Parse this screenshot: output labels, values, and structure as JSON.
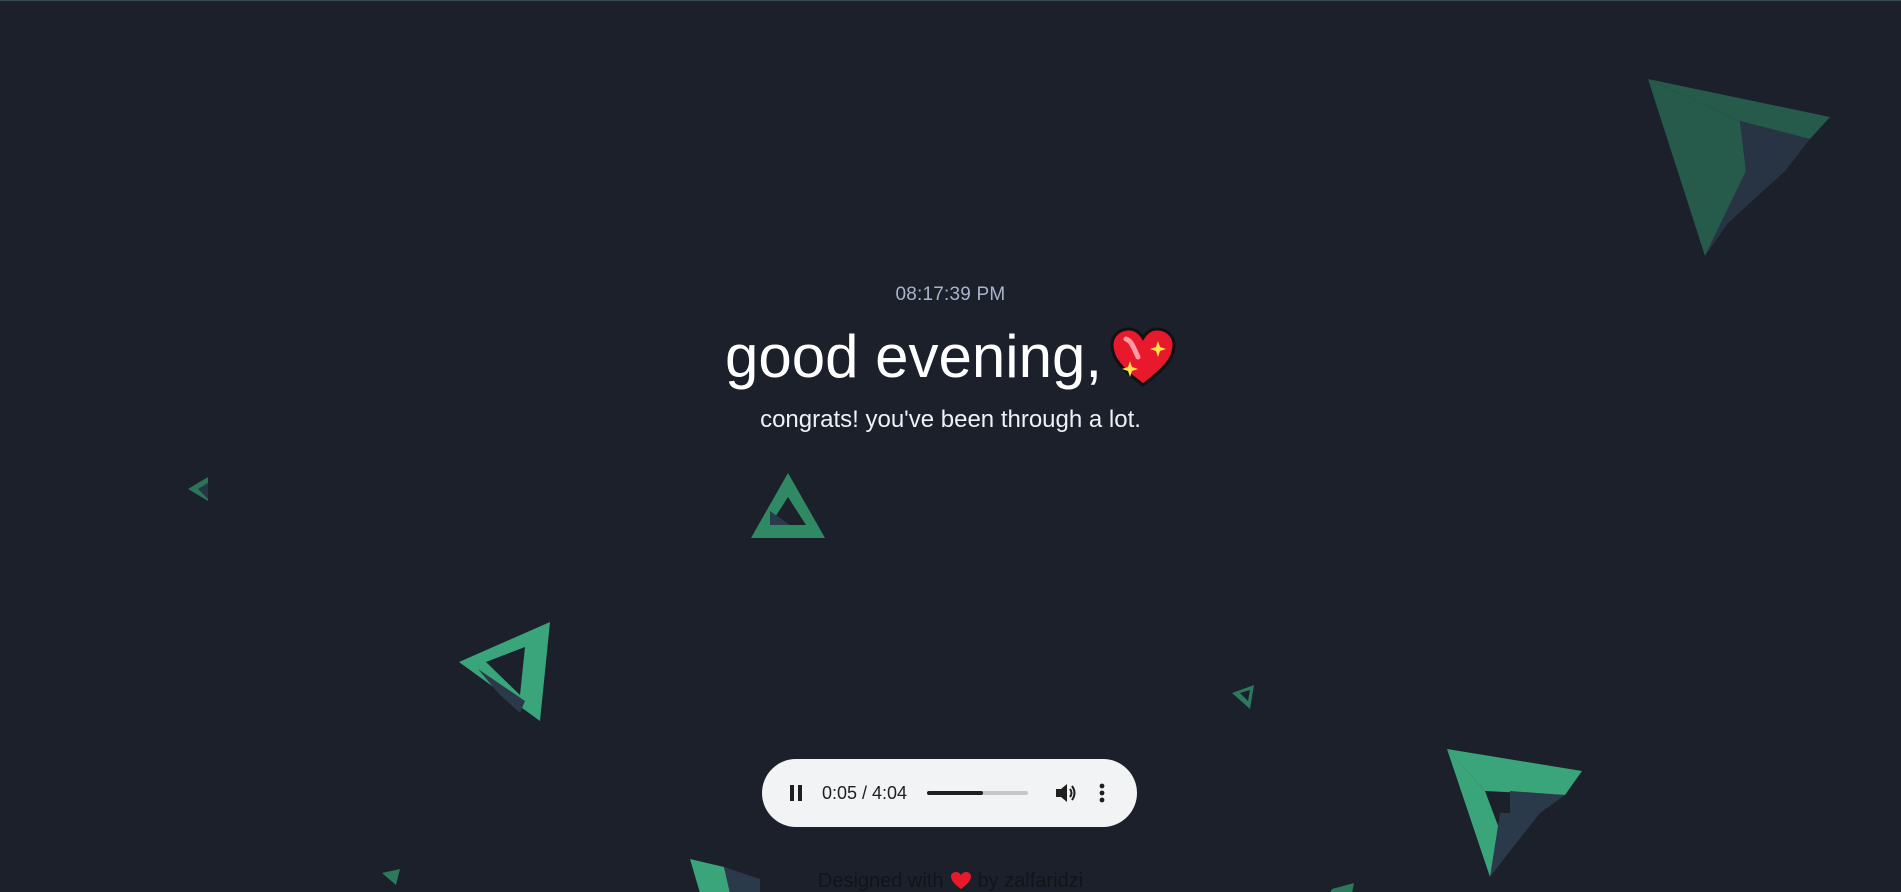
{
  "clock": {
    "time": "08:17:39 PM"
  },
  "greeting": {
    "text": "good evening,",
    "emoji": "sparkling-heart-icon"
  },
  "subtitle": {
    "text": "congrats! you've been through a lot."
  },
  "audio_player": {
    "state": "playing",
    "current_time": "0:05",
    "duration": "4:04",
    "time_display": "0:05 / 4:04",
    "buffered_fraction": 0.55,
    "played_fraction": 0.02,
    "icons": [
      "pause-icon",
      "volume-icon",
      "more-options-icon"
    ]
  },
  "footer": {
    "prefix": "Designed with",
    "suffix": "by zalfaridzi",
    "icon": "heart-icon"
  },
  "colors": {
    "background": "#1b202b",
    "accent_green": "#3aa57a",
    "accent_slate": "#2b3a4a",
    "player_bg": "#f1f3f4",
    "clock_text": "#a9b4cc"
  }
}
